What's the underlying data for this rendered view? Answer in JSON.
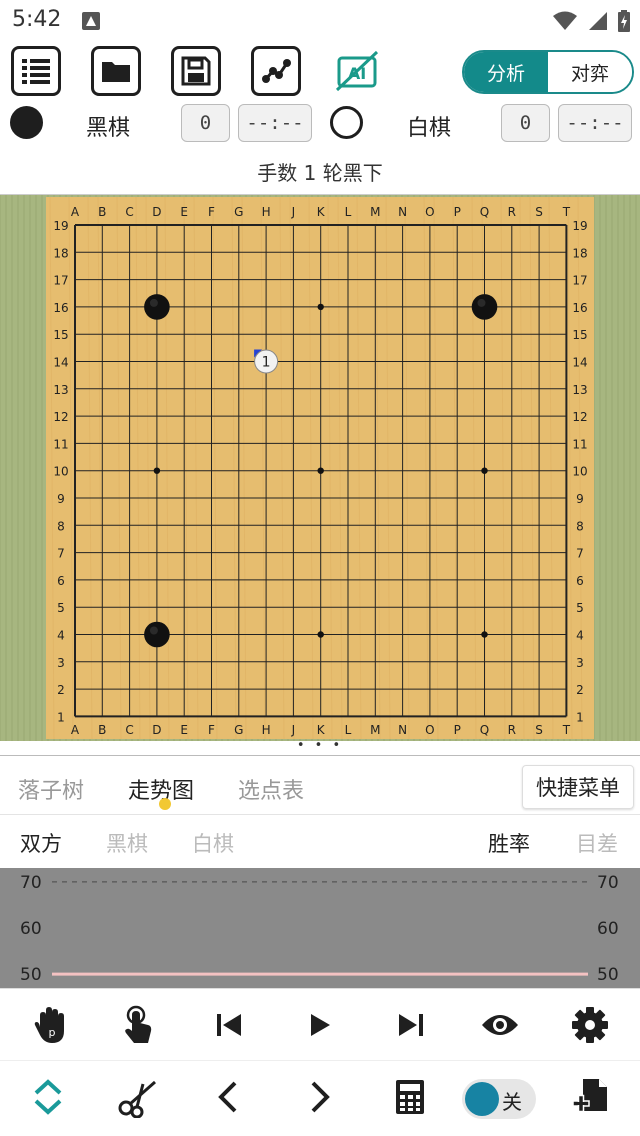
{
  "status_bar": {
    "time": "5:42"
  },
  "toolbar": {
    "buttons": [
      "list-icon",
      "folder-icon",
      "save-icon",
      "tree-icon",
      "ai-off-icon"
    ],
    "segment": {
      "analyze": "分析",
      "play": "对弈",
      "selected": "分析"
    }
  },
  "players": {
    "black": {
      "name": "黑棋",
      "captures": "0",
      "timer": "--:--"
    },
    "white": {
      "name": "白棋",
      "captures": "0",
      "timer": "--:--"
    }
  },
  "move_info": "手数 1  轮黑下",
  "board": {
    "size": 19,
    "columns": [
      "A",
      "B",
      "C",
      "D",
      "E",
      "F",
      "G",
      "H",
      "J",
      "K",
      "L",
      "M",
      "N",
      "O",
      "P",
      "Q",
      "R",
      "S",
      "T"
    ],
    "black_stones": [
      "D16",
      "Q16",
      "D4"
    ],
    "white_stones": [],
    "hint_stones": [
      {
        "point": "H14",
        "label": "1"
      }
    ],
    "star_points": [
      "D16",
      "K16",
      "Q16",
      "D10",
      "K10",
      "Q10",
      "D4",
      "K4",
      "Q4"
    ],
    "colors": {
      "wood": "#e6bd6f",
      "line": "#222222",
      "mat": "#a7b680"
    }
  },
  "handle": "• • •",
  "tabs": {
    "items": [
      "落子树",
      "走势图",
      "选点表"
    ],
    "selected": "走势图",
    "quick_menu": "快捷菜单"
  },
  "filters": {
    "both": "双方",
    "black": "黑棋",
    "white": "白棋",
    "win_rate": "胜率",
    "score": "目差"
  },
  "chart_data": {
    "type": "line",
    "title": "",
    "xlabel": "",
    "ylabel": "",
    "yticks": [
      "70",
      "60",
      "50"
    ],
    "ylim": [
      47,
      73
    ],
    "reference_line": 70,
    "series": [
      {
        "values": [
          50,
          50
        ]
      }
    ],
    "colors": {
      "background": "#8a8a8a",
      "series": "#f4c2c2",
      "reference": "#555555"
    }
  },
  "controls": {
    "row1": [
      "pass-icon",
      "touch-icon",
      "first-move-icon",
      "play-icon",
      "last-move-icon",
      "eye-icon",
      "settings-icon"
    ],
    "row2": [
      "expand-collapse-icon",
      "cut-icon",
      "prev-icon",
      "next-icon",
      "calculator-icon",
      "toggle",
      "add-file-icon"
    ],
    "toggle_label": "关"
  }
}
